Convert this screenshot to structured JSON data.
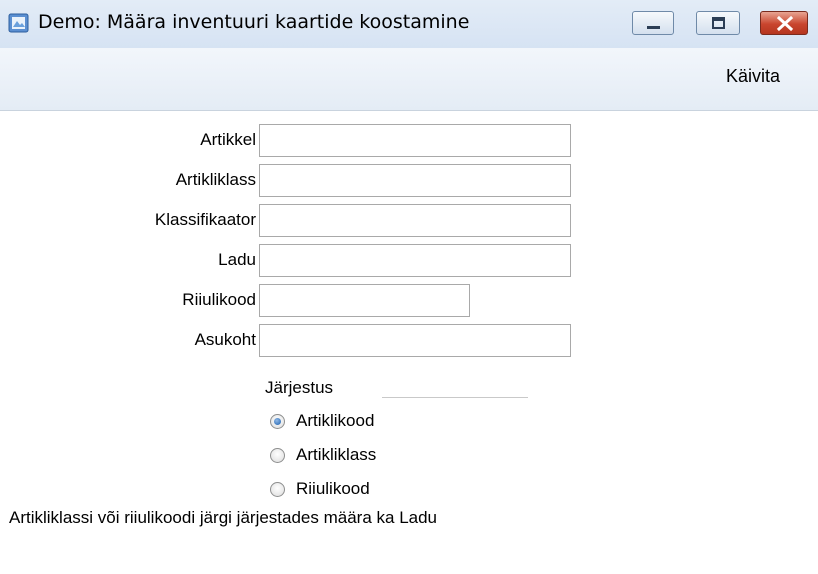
{
  "window": {
    "title": "Demo: Määra inventuuri kaartide koostamine",
    "app_icon": "app-window-icon",
    "controls": {
      "minimize_icon": "minimize-icon",
      "maximize_icon": "maximize-icon",
      "close_icon": "close-icon"
    }
  },
  "toolbar": {
    "run_label": "Käivita"
  },
  "form": {
    "fields": [
      {
        "label": "Artikkel",
        "value": ""
      },
      {
        "label": "Artikliklass",
        "value": ""
      },
      {
        "label": "Klassifikaator",
        "value": ""
      },
      {
        "label": "Ladu",
        "value": ""
      },
      {
        "label": "Riiulikood",
        "value": ""
      },
      {
        "label": "Asukoht",
        "value": ""
      }
    ]
  },
  "sort_group": {
    "label": "Järjestus",
    "options": [
      {
        "label": "Artiklikood",
        "selected": true
      },
      {
        "label": "Artikliklass",
        "selected": false
      },
      {
        "label": "Riiulikood",
        "selected": false
      }
    ]
  },
  "footer": {
    "note": "Artikliklassi või riiulikoodi järgi järjestades määra ka Ladu"
  },
  "colors": {
    "titlebar": "#dce7f5",
    "close_button": "#c9452e",
    "radio_selected": "#1b5fae"
  }
}
